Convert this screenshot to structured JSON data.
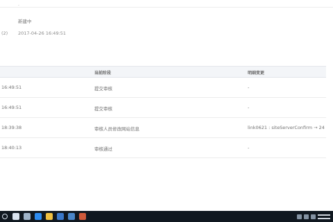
{
  "detail": {
    "line1": "·",
    "line2": "新建中",
    "label3": "(2)",
    "line3": "2017-04-26 16:49:51"
  },
  "table": {
    "headers": [
      "",
      "当前阶段",
      "明细变更"
    ],
    "rows": [
      {
        "time": "16:49:51",
        "stage": "提交审核",
        "change": "-"
      },
      {
        "time": "16:49:51",
        "stage": "提交审核",
        "change": "-"
      },
      {
        "time": "18:39:38",
        "stage": "审核人员修改网站信息",
        "change": "link0621 : siteServerConfirm → 24"
      },
      {
        "time": "18:40:13",
        "stage": "审核通过",
        "change": "-"
      }
    ]
  },
  "taskbar": {
    "apps": [
      {
        "name": "start-button",
        "color": "#d9e3ef"
      },
      {
        "name": "search-icon",
        "color": "#d9e3ef"
      },
      {
        "name": "task-view-icon",
        "color": "#9fb4c9"
      },
      {
        "name": "browser-icon",
        "color": "#2d8cf0"
      },
      {
        "name": "folder-icon",
        "color": "#f0c040"
      },
      {
        "name": "store-icon",
        "color": "#3a78c9"
      },
      {
        "name": "mail-icon",
        "color": "#4b86c8"
      },
      {
        "name": "app-icon",
        "color": "#cf5a3a"
      }
    ]
  }
}
